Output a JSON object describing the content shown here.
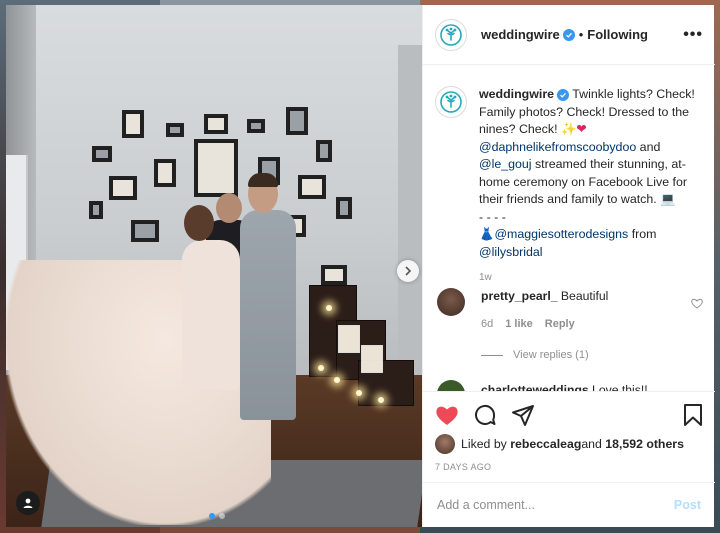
{
  "post": {
    "author": "weddingwire",
    "follow_separator": "•",
    "follow_status": "Following",
    "more_options": "•••",
    "caption": {
      "author": "weddingwire",
      "line1": "Twinkle lights? Check! Family photos? Check! Dressed to the nines? Check! ",
      "mention1": "@daphnelikefromscoobydoo",
      "and": " and ",
      "mention2": "@le_gouj",
      "line2": " streamed their stunning, at-home ceremony on Facebook Live for their friends and family to watch. ",
      "dashes": "- - - -",
      "mention3": "@maggiesotterodesigns",
      "from": " from ",
      "mention4": "@lilysbridal"
    },
    "caption_age": "1w",
    "comments": [
      {
        "user": "pretty_pearl_",
        "text": " Beautiful",
        "age": "6d",
        "likes": "1 like",
        "reply": "Reply",
        "view_replies": "View replies (1)"
      },
      {
        "user": "charlotteweddings",
        "text": " Love this!!"
      }
    ],
    "liked_by_prefix": "Liked by ",
    "liked_by_user": "rebeccaleag",
    "liked_by_suffix": " and ",
    "liked_by_count": "18,592 others",
    "posted_ago": "7 DAYS AGO",
    "comment_placeholder": "Add a comment...",
    "post_button": "Post",
    "carousel": {
      "count": 2,
      "active": 0
    }
  },
  "colors": {
    "brand": "#25a9b8",
    "verified": "#3897f0",
    "like_red": "#ed4956",
    "post_disabled": "#b2dffc"
  },
  "icons": [
    "weddingwire-logo-icon",
    "verified-icon",
    "heart-icon",
    "comment-icon",
    "share-icon",
    "bookmark-icon",
    "chevron-right-icon",
    "user-tag-icon"
  ]
}
